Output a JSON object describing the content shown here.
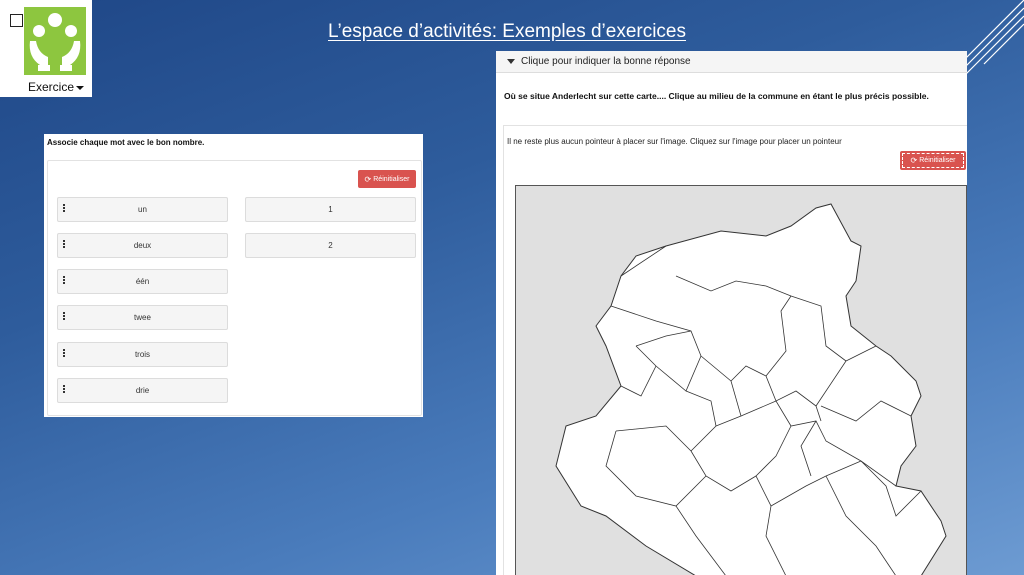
{
  "slide": {
    "title": "L’espace d’activités: Exemples d’exercices"
  },
  "logo": {
    "label": "Exercice",
    "icon": "juggling-hands-icon",
    "color": "#8dc63f"
  },
  "left_panel": {
    "instruction": "Associe chaque mot avec le bon nombre.",
    "reset_label": "Réinitialiser",
    "words": [
      "un",
      "deux",
      "één",
      "twee",
      "trois",
      "drie"
    ],
    "numbers": [
      "1",
      "2"
    ]
  },
  "right_panel": {
    "header": "Clique pour indiquer la bonne réponse",
    "question": "Où se situe Anderlecht sur cette carte.... Clique au milieu de la commune en étant le plus précis possible.",
    "status": "Il ne reste plus aucun pointeur à placer sur l'image. Cliquez sur l'image pour placer un pointeur",
    "reset_label": "Réinitialiser",
    "map": "brussels-communes-map"
  },
  "colors": {
    "reset_button": "#d9534f",
    "background_top": "#1f4787",
    "background_bottom": "#6d9bd2"
  }
}
